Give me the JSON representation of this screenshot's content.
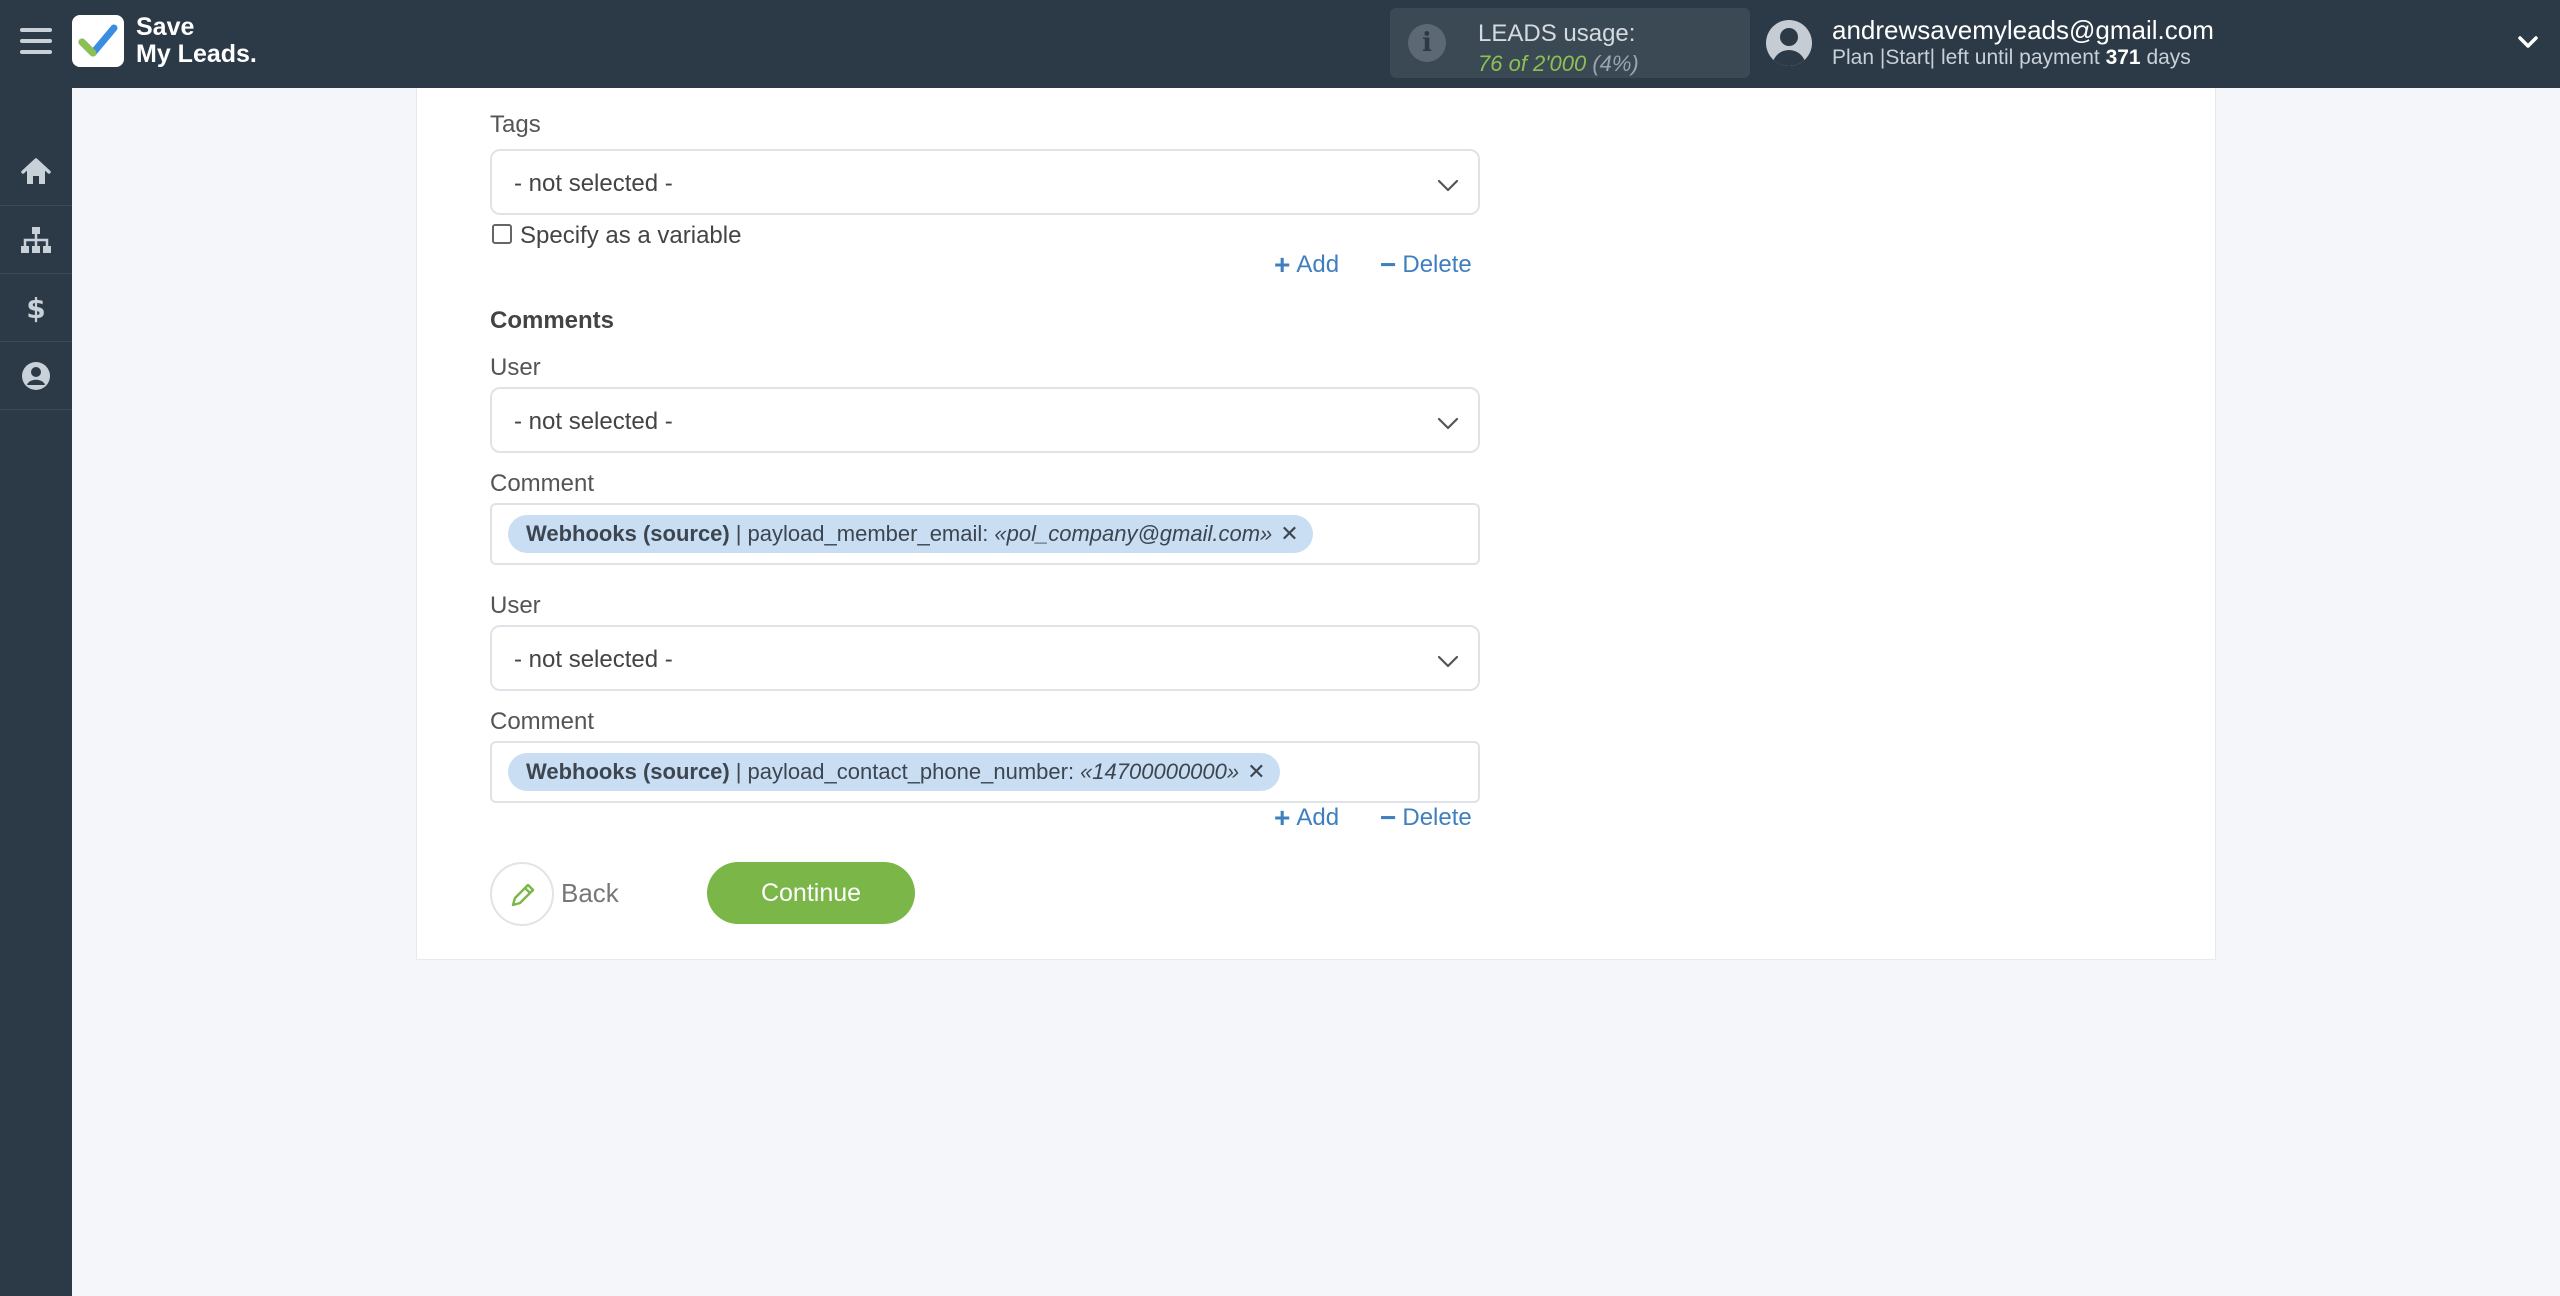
{
  "header": {
    "logo_line1": "Save",
    "logo_line2": "My Leads.",
    "usage_title": "LEADS usage:",
    "usage_count": "76 of 2'000",
    "usage_percent": "(4%)",
    "email": "andrewsavemyleads@gmail.com",
    "plan_prefix": "Plan |Start| left until payment",
    "plan_days": "371",
    "plan_suffix": "days"
  },
  "sidebar": {
    "items": [
      {
        "icon": "home-icon"
      },
      {
        "icon": "sitemap-icon"
      },
      {
        "icon": "dollar-icon"
      },
      {
        "icon": "user-circle-icon"
      }
    ]
  },
  "form": {
    "tags_label": "Tags",
    "tags_value": "- not selected -",
    "specify_variable": "Specify as a variable",
    "add_label": "Add",
    "delete_label": "Delete",
    "comments_label": "Comments",
    "comments": [
      {
        "user_label": "User",
        "user_value": "- not selected -",
        "comment_label": "Comment",
        "chip_source": "Webhooks (source)",
        "chip_sep": "|",
        "chip_field": "payload_member_email:",
        "chip_example": "«pol_company@gmail.com»"
      },
      {
        "user_label": "User",
        "user_value": "- not selected -",
        "comment_label": "Comment",
        "chip_source": "Webhooks (source)",
        "chip_sep": "|",
        "chip_field": "payload_contact_phone_number:",
        "chip_example": "«14700000000»"
      }
    ],
    "back_label": "Back",
    "continue_label": "Continue"
  },
  "colors": {
    "topbar": "#2c3a47",
    "accent_green": "#7ab648",
    "link_blue": "#3f7fbf",
    "chip_bg": "#c9def3"
  }
}
